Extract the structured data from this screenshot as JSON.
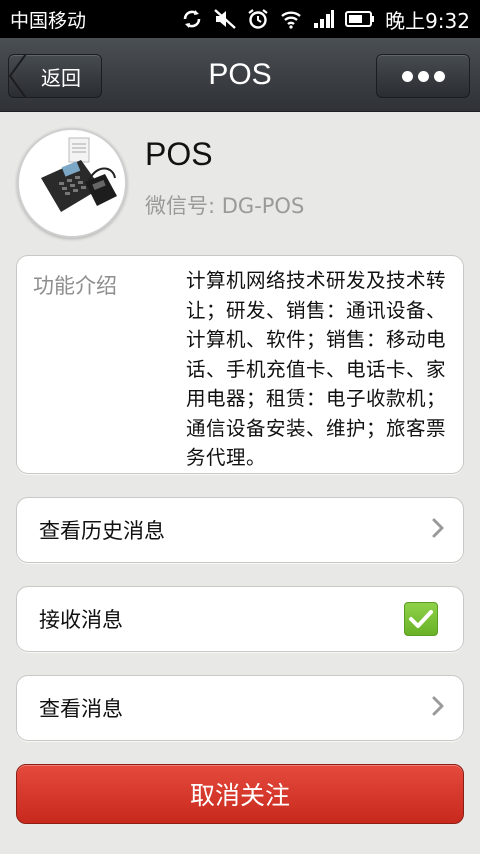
{
  "status_bar": {
    "carrier": "中国移动",
    "time": "晚上9:32",
    "icons": [
      "sync-icon",
      "mute-icon",
      "alarm-icon",
      "wifi-icon",
      "signal-icon",
      "battery-icon"
    ]
  },
  "header": {
    "back_label": "返回",
    "title": "POS",
    "more_icon": "more-dots-icon"
  },
  "profile": {
    "name": "POS",
    "wechat_id": "微信号: DG-POS",
    "avatar_icon": "pos-terminal-avatar"
  },
  "intro": {
    "label": "功能介绍",
    "text": "计算机网络技术研发及技术转让；研发、销售：通讯设备、计算机、软件；销售：移动电话、手机充值卡、电话卡、家用电器；租赁：电子收款机；通信设备安装、维护；旅客票务代理。"
  },
  "rows": {
    "history_label": "查看历史消息",
    "receive_label": "接收消息",
    "receive_checked": true,
    "view_label": "查看消息"
  },
  "unfollow_label": "取消关注",
  "colors": {
    "background": "#e8e8e6",
    "title_bar": "#3a3e42",
    "unfollow": "#d6362a",
    "checkbox": "#7bc236"
  }
}
